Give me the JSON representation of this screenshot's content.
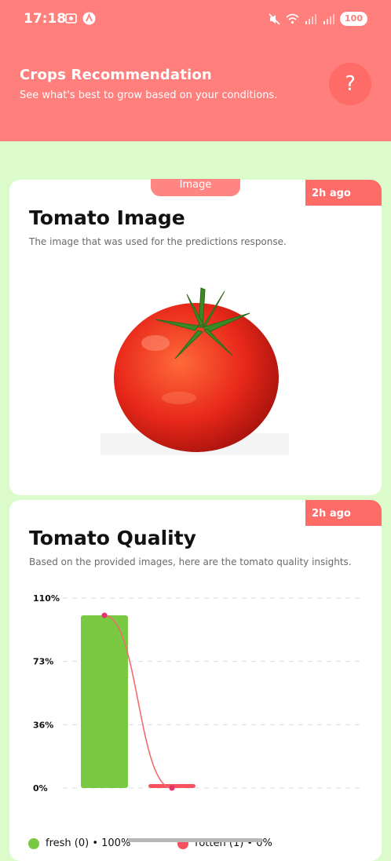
{
  "status_bar": {
    "time": "17:18",
    "battery": "100",
    "icons": [
      "screen-record-icon",
      "app-a-icon",
      "mute-icon",
      "wifi-icon",
      "signal-icon",
      "signal-icon",
      "battery-icon"
    ]
  },
  "header": {
    "title": "Crops Recommendation",
    "subtitle": "See what's best to grow based on your conditions.",
    "help_label": "?"
  },
  "image_card": {
    "tag": "Image",
    "time": "2h ago",
    "title": "Tomato Image",
    "description": "The image that was used for the predictions response."
  },
  "quality_card": {
    "time": "2h ago",
    "title": "Tomato Quality",
    "description": "Based on the provided images, here are the tomato quality insights."
  },
  "chart_data": {
    "type": "bar",
    "categories": [
      "fresh (0)",
      "rotten (1)"
    ],
    "values": [
      100,
      0
    ],
    "y_ticks": [
      "110%",
      "73%",
      "36%",
      "0%"
    ],
    "ylim": [
      0,
      110
    ],
    "legend": [
      "fresh (0) • 100%",
      "rotten (1) • 0%"
    ],
    "colors": {
      "fresh": "#79c942",
      "rotten": "#f5515f",
      "line": "#f26b6b",
      "point": "#e8306e"
    },
    "grid": true,
    "legend_position": "bottom"
  },
  "colors": {
    "accent": "#ff7f7c",
    "background": "#dcfbcb",
    "badge": "#ff6b67"
  }
}
